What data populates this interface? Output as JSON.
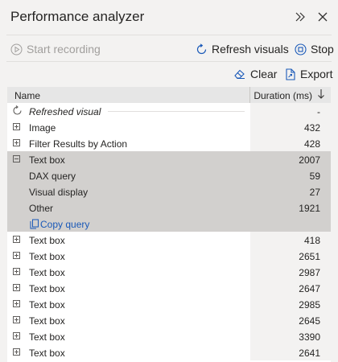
{
  "panel": {
    "title": "Performance analyzer"
  },
  "toolbar": {
    "start_recording": "Start recording",
    "refresh_visuals": "Refresh visuals",
    "stop": "Stop",
    "clear": "Clear",
    "export": "Export"
  },
  "table": {
    "columns": {
      "name": "Name",
      "duration": "Duration (ms)"
    },
    "rows": [
      {
        "label": "Refreshed visual",
        "duration": "-"
      },
      {
        "label": "Image",
        "duration": "432"
      },
      {
        "label": "Filter Results by Action",
        "duration": "428"
      },
      {
        "label": "Text box",
        "duration": "2007"
      },
      {
        "label": "DAX query",
        "duration": "59"
      },
      {
        "label": "Visual display",
        "duration": "27"
      },
      {
        "label": "Other",
        "duration": "1921"
      },
      {
        "label": "Copy query",
        "duration": ""
      },
      {
        "label": "Text box",
        "duration": "418"
      },
      {
        "label": "Text box",
        "duration": "2651"
      },
      {
        "label": "Text box",
        "duration": "2987"
      },
      {
        "label": "Text box",
        "duration": "2647"
      },
      {
        "label": "Text box",
        "duration": "2985"
      },
      {
        "label": "Text box",
        "duration": "2645"
      },
      {
        "label": "Text box",
        "duration": "3390"
      },
      {
        "label": "Text box",
        "duration": "2641"
      }
    ]
  },
  "colors": {
    "panel_bg": "#f3f2f1",
    "selected_row": "#d2d0ce",
    "link_blue": "#1a59b8",
    "header_bg": "#e6e6e6"
  },
  "icons": {
    "expand": "double-chevron-right-icon",
    "close": "close-icon",
    "start": "play-circle-icon",
    "refresh": "refresh-icon",
    "stop": "stop-circle-icon",
    "clear": "eraser-icon",
    "export": "document-export-icon",
    "sort": "arrow-down-icon",
    "copy": "copy-icon"
  }
}
